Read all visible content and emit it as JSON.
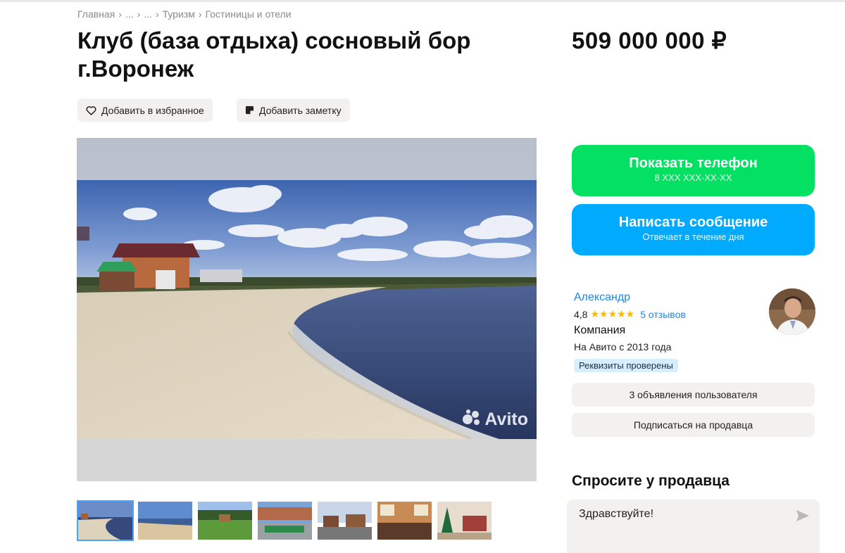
{
  "breadcrumb": [
    "Главная",
    "...",
    "...",
    "Туризм",
    "Гостиницы и отели"
  ],
  "breadcrumb_separator": "›",
  "listing": {
    "title": "Клуб (база отдыха) сосновый бор г.Воронеж",
    "price": "509 000 000 ₽"
  },
  "actions": {
    "favorite_label": "Добавить в избранное",
    "note_label": "Добавить заметку"
  },
  "gallery": {
    "watermark": "Avito",
    "thumbnail_count": 7
  },
  "contact": {
    "phone_label": "Показать телефон",
    "phone_masked": "8 XXX XXX-XX-XX",
    "message_label": "Написать сообщение",
    "message_sub": "Отвечает в течение дня",
    "phone_color": "#04e061",
    "message_color": "#00aaff"
  },
  "seller": {
    "name": "Александр",
    "rating": "4,8",
    "stars": "★★★★★",
    "reviews": "5 отзывов",
    "type": "Компания",
    "since": "На Авито с 2013 года",
    "badge": "Реквизиты проверены",
    "listings_button": "3 объявления пользователя",
    "subscribe_button": "Подписаться на продавца"
  },
  "ask": {
    "title": "Спросите у продавца",
    "message": "Здравствуйте!"
  }
}
